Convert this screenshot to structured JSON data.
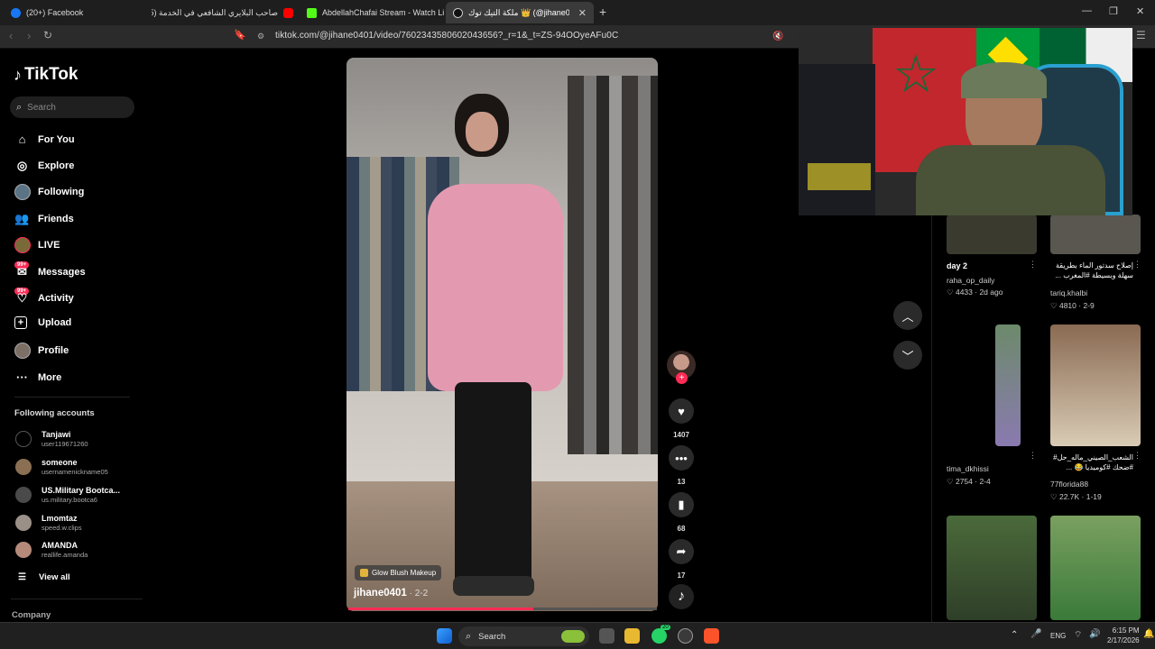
{
  "browser": {
    "tabs": [
      {
        "label": "(20+) Facebook",
        "color": "#1877f2"
      },
      {
        "label": "صاحب البلايري الشافعي في الخدمة (5)",
        "color": "#ff0000"
      },
      {
        "label": "AbdellahChafai Stream - Watch Live",
        "color": "#53fc18"
      },
      {
        "label": "ملكة التيك توك 👑 (@jihane0401)",
        "color": "#000000",
        "active": true
      }
    ],
    "new_tab_icon": "plus-icon",
    "url": "tiktok.com/@jihane0401/video/7602343580602043656?_r=1&_t=ZS-94OOyeAFu0C"
  },
  "sidebar": {
    "logo_text": "TikTok",
    "search_placeholder": "Search",
    "nav": [
      {
        "label": "For You",
        "icon": "home-icon"
      },
      {
        "label": "Explore",
        "icon": "compass-icon"
      },
      {
        "label": "Following",
        "icon": "avatar-icon"
      },
      {
        "label": "Friends",
        "icon": "friends-icon"
      },
      {
        "label": "LIVE",
        "icon": "live-icon"
      },
      {
        "label": "Messages",
        "icon": "messages-icon",
        "badge": "99+"
      },
      {
        "label": "Activity",
        "icon": "activity-icon",
        "badge": "99+"
      },
      {
        "label": "Upload",
        "icon": "upload-icon"
      },
      {
        "label": "Profile",
        "icon": "profile-icon"
      },
      {
        "label": "More",
        "icon": "more-icon"
      }
    ],
    "following_title": "Following accounts",
    "accounts": [
      {
        "name": "Tanjawi",
        "user": "user119671260"
      },
      {
        "name": "someone",
        "user": "usernamenickname05"
      },
      {
        "name": "US.Military Bootca...",
        "user": "us.military.bootca6"
      },
      {
        "name": "Lmomtaz",
        "user": "speed.w.clips"
      },
      {
        "name": "AMANDA",
        "user": "reallife.amanda"
      }
    ],
    "view_all": "View all",
    "company": "Company"
  },
  "video": {
    "tag": "Glow Blush Makeup",
    "author": "jihane0401",
    "date": " · 2-2",
    "progress": 0.6
  },
  "actions": {
    "likes": "1407",
    "comments": "13",
    "saves": "68",
    "shares": "17"
  },
  "recommended": [
    {
      "title": "day 2",
      "user": "raha_op_daily",
      "likes": "♡ 4433 · 2d ago"
    },
    {
      "title": "إصلاح سدتور الماء بطريقة سهلة وبسيطة #المغرب ...",
      "user": "tariq.khalbi",
      "likes": "♡ 4810 · 2-9"
    },
    {
      "title": "",
      "user": "tima_dkhissi",
      "likes": "♡ 2754 · 2-4"
    },
    {
      "title": "الشعب_الصيني_ماله_حل# #ضحك #كوميديا 😂 ...",
      "user": "77florida88",
      "likes": "♡ 22.7K · 1-19"
    }
  ],
  "taskbar": {
    "search": "Search",
    "whatsapp_badge": "20",
    "lang": "ENG",
    "time": "6:15 PM",
    "date": "2/17/2026"
  }
}
